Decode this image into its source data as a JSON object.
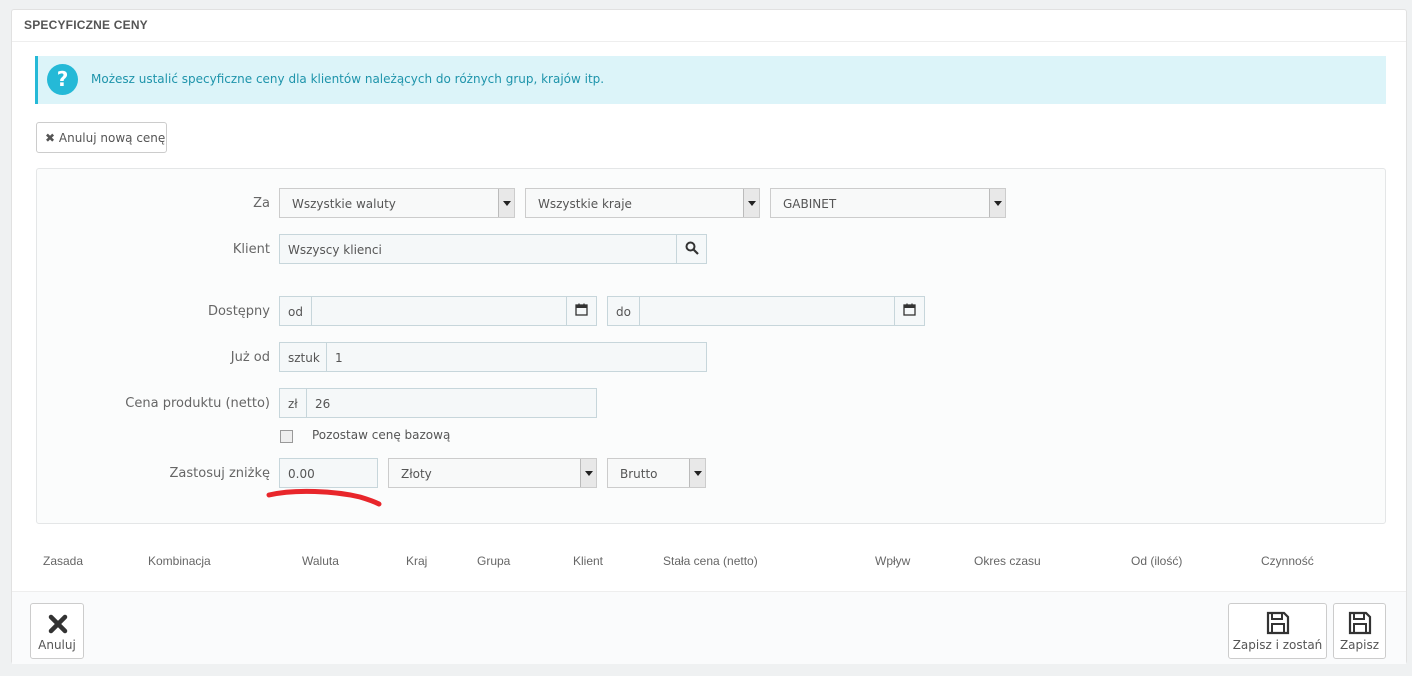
{
  "panel": {
    "title": "SPECYFICZNE CENY"
  },
  "alert": {
    "icon": "question-icon",
    "glyph": "?",
    "text": "Możesz ustalić specyficzne ceny dla klientów należących do różnych grup, krajów itp."
  },
  "cancel_new_button": {
    "label": "Anuluj nową cenę",
    "icon": "close-icon"
  },
  "form": {
    "za_label": "Za",
    "currency": "Wszystkie waluty",
    "country": "Wszystkie kraje",
    "group": "GABINET",
    "client_label": "Klient",
    "client_value": "Wszyscy klienci",
    "available_label": "Dostępny",
    "from_prefix": "od",
    "to_prefix": "do",
    "from_value": "",
    "to_value": "",
    "from_qty_label": "Już od",
    "qty_prefix": "sztuk",
    "qty_value": "1",
    "price_label": "Cena produktu (netto)",
    "price_prefix": "zł",
    "price_value": "26",
    "keep_base_label": "Pozostaw cenę bazową",
    "keep_base_checked": false,
    "discount_label": "Zastosuj zniżkę",
    "discount_value": "0.00",
    "discount_type": "Złoty",
    "discount_tax": "Brutto"
  },
  "table": {
    "columns": [
      "Zasada",
      "Kombinacja",
      "Waluta",
      "Kraj",
      "Grupa",
      "Klient",
      "Stała cena (netto)",
      "Wpływ",
      "Okres czasu",
      "Od (ilość)",
      "Czynność"
    ]
  },
  "footer": {
    "cancel_label": "Anuluj",
    "save_stay_label": "Zapisz i zostań",
    "save_label": "Zapisz"
  },
  "colors": {
    "accent": "#25b9d7",
    "alert_bg": "#dcf4f9",
    "annotation": "#e8262b"
  }
}
